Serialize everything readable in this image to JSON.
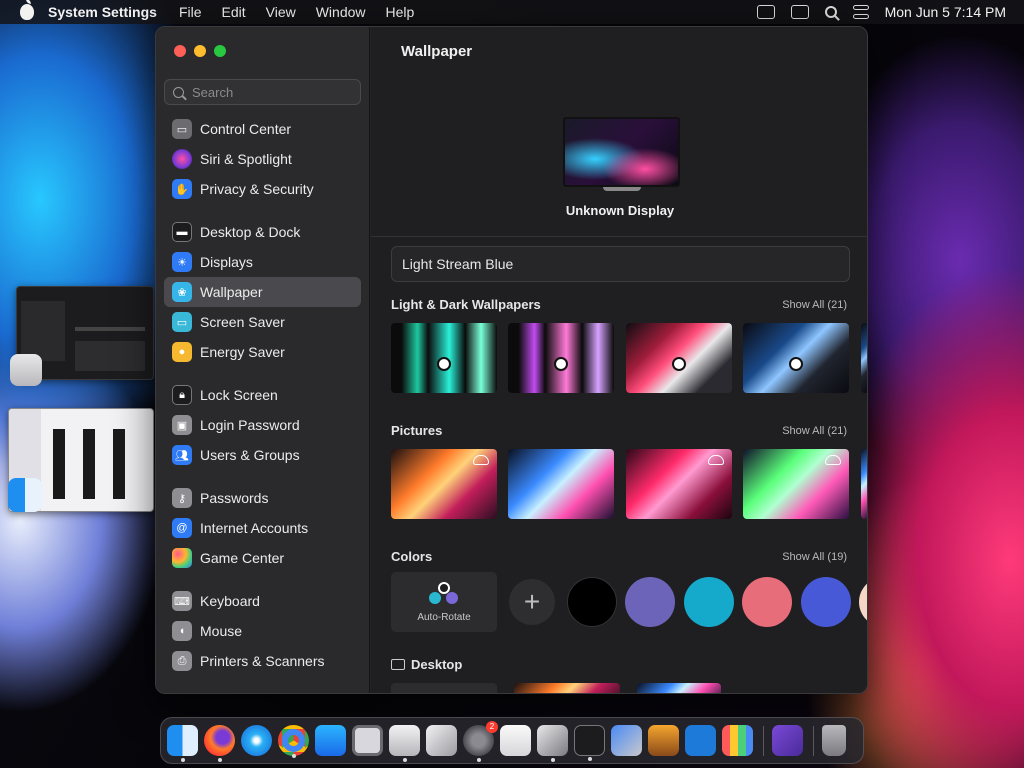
{
  "menubar": {
    "app_name": "System Settings",
    "menus": [
      "File",
      "Edit",
      "View",
      "Window",
      "Help"
    ],
    "clock": "Mon Jun 5  7:14 PM"
  },
  "sidebar": {
    "search_placeholder": "Search",
    "items": [
      {
        "label": "Control Center",
        "icon": "control-center-icon",
        "color": "#6b6b70"
      },
      {
        "label": "Siri & Spotlight",
        "icon": "siri-icon",
        "color": "#b03ad6"
      },
      {
        "label": "Privacy & Security",
        "icon": "hand-icon",
        "color": "#2f7bf5"
      },
      {
        "label": "Desktop & Dock",
        "icon": "desktop-dock-icon",
        "color": "#1c1c1e"
      },
      {
        "label": "Displays",
        "icon": "sun-icon",
        "color": "#2f7bf5"
      },
      {
        "label": "Wallpaper",
        "icon": "wallpaper-icon",
        "color": "#36b6e8"
      },
      {
        "label": "Screen Saver",
        "icon": "screen-saver-icon",
        "color": "#3ab8d8"
      },
      {
        "label": "Energy Saver",
        "icon": "bulb-icon",
        "color": "#f5b82e"
      },
      {
        "label": "Lock Screen",
        "icon": "lock-icon",
        "color": "#1c1c1e"
      },
      {
        "label": "Login Password",
        "icon": "lock-icon",
        "color": "#8e8e93"
      },
      {
        "label": "Users & Groups",
        "icon": "users-icon",
        "color": "#2f7bf5"
      },
      {
        "label": "Passwords",
        "icon": "key-icon",
        "color": "#8e8e93"
      },
      {
        "label": "Internet Accounts",
        "icon": "at-icon",
        "color": "#2f7bf5"
      },
      {
        "label": "Game Center",
        "icon": "game-center-icon",
        "color": "#e84a8a"
      },
      {
        "label": "Keyboard",
        "icon": "keyboard-icon",
        "color": "#8e8e93"
      },
      {
        "label": "Mouse",
        "icon": "mouse-icon",
        "color": "#8e8e93"
      },
      {
        "label": "Printers & Scanners",
        "icon": "printer-icon",
        "color": "#8e8e93"
      }
    ],
    "selected": "Wallpaper"
  },
  "main": {
    "title": "Wallpaper",
    "display_name": "Unknown Display",
    "current_wallpaper": "Light Stream Blue",
    "sections": {
      "light_dark": {
        "title": "Light & Dark Wallpapers",
        "show_all": "Show All (21)"
      },
      "pictures": {
        "title": "Pictures",
        "show_all": "Show All (21)"
      },
      "colors": {
        "title": "Colors",
        "show_all": "Show All (19)",
        "auto_rotate_label": "Auto-Rotate",
        "add_symbol": "+"
      },
      "desktop": {
        "title": "Desktop"
      }
    },
    "color_swatches": [
      "#000000",
      "#6c64b8",
      "#15a9cc",
      "#e76d7a",
      "#4759d6"
    ]
  },
  "dock": {
    "apps": [
      "finder-icon",
      "firefox-icon",
      "safari-icon",
      "chrome-icon",
      "app-store-icon",
      "screenshot-icon",
      "preview-icon",
      "script-editor-icon",
      "system-settings-icon",
      "textedit-icon",
      "disk-utility-icon",
      "terminal-icon",
      "xcode-icon",
      "garageband-icon",
      "vscode-icon",
      "launchpad-icon",
      "visual-studio-icon",
      "trash-icon"
    ],
    "notification_badge": "2"
  }
}
